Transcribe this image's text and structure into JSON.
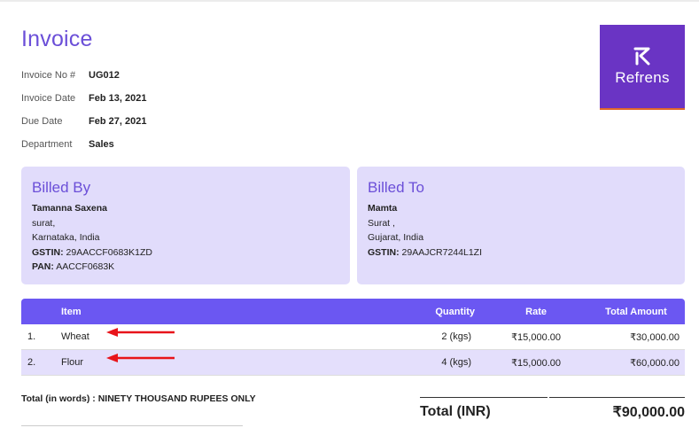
{
  "invoice": {
    "title": "Invoice",
    "meta": [
      {
        "label": "Invoice No #",
        "value": "UG012"
      },
      {
        "label": "Invoice Date",
        "value": "Feb 13, 2021"
      },
      {
        "label": "Due Date",
        "value": "Feb 27, 2021"
      },
      {
        "label": "Department",
        "value": "Sales"
      }
    ],
    "logo_text": "Refrens"
  },
  "billed_by": {
    "title": "Billed By",
    "name": "Tamanna Saxena",
    "city": "surat,",
    "state": "Karnataka, India",
    "gstin_label": "GSTIN:",
    "gstin": "29AACCF0683K1ZD",
    "pan_label": "PAN:",
    "pan": "AACCF0683K"
  },
  "billed_to": {
    "title": "Billed To",
    "name": "Mamta",
    "city": "Surat ,",
    "state": "Gujarat, India",
    "gstin_label": "GSTIN:",
    "gstin": "29AAJCR7244L1ZI"
  },
  "table": {
    "headers": {
      "num": "",
      "item": "Item",
      "quantity": "Quantity",
      "rate": "Rate",
      "amount": "Total Amount"
    },
    "rows": [
      {
        "num": "1.",
        "item": "Wheat",
        "quantity": "2 (kgs)",
        "rate": "₹15,000.00",
        "amount": "₹30,000.00"
      },
      {
        "num": "2.",
        "item": "Flour",
        "quantity": "4 (kgs)",
        "rate": "₹15,000.00",
        "amount": "₹60,000.00"
      }
    ]
  },
  "total_words": "Total (in words) : NINETY THOUSAND RUPEES ONLY",
  "totals": {
    "label": "Total (INR)",
    "value": "₹90,000.00"
  },
  "colors": {
    "accent": "#6b4fd8",
    "header_bg": "#6b57f2",
    "panel_bg": "#e1dcfb",
    "logo_bg": "#6a34c4",
    "arrow": "#e8141a"
  }
}
